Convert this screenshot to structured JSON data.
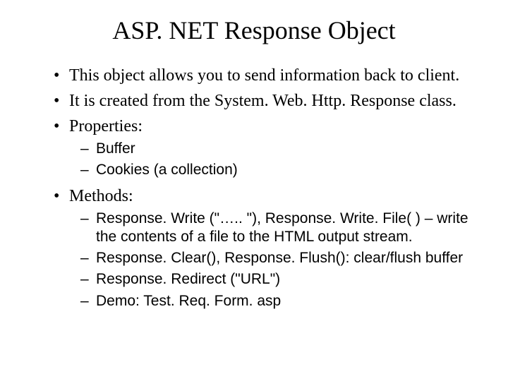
{
  "title": "ASP. NET Response Object",
  "bullets": {
    "b0": "This object allows you to send information back to client.",
    "b1": "It is created from the System. Web. Http. Response class.",
    "b2": "Properties:",
    "b2_subs": {
      "s0": "Buffer",
      "s1": "Cookies (a collection)"
    },
    "b3": "Methods:",
    "b3_subs": {
      "s0": "Response. Write (\"….. \"), Response. Write. File( ) – write the contents of a file to the HTML output stream.",
      "s1": "Response. Clear(), Response. Flush(): clear/flush buffer",
      "s2": "Response. Redirect (\"URL\")",
      "s3": "Demo: Test. Req. Form. asp"
    }
  }
}
